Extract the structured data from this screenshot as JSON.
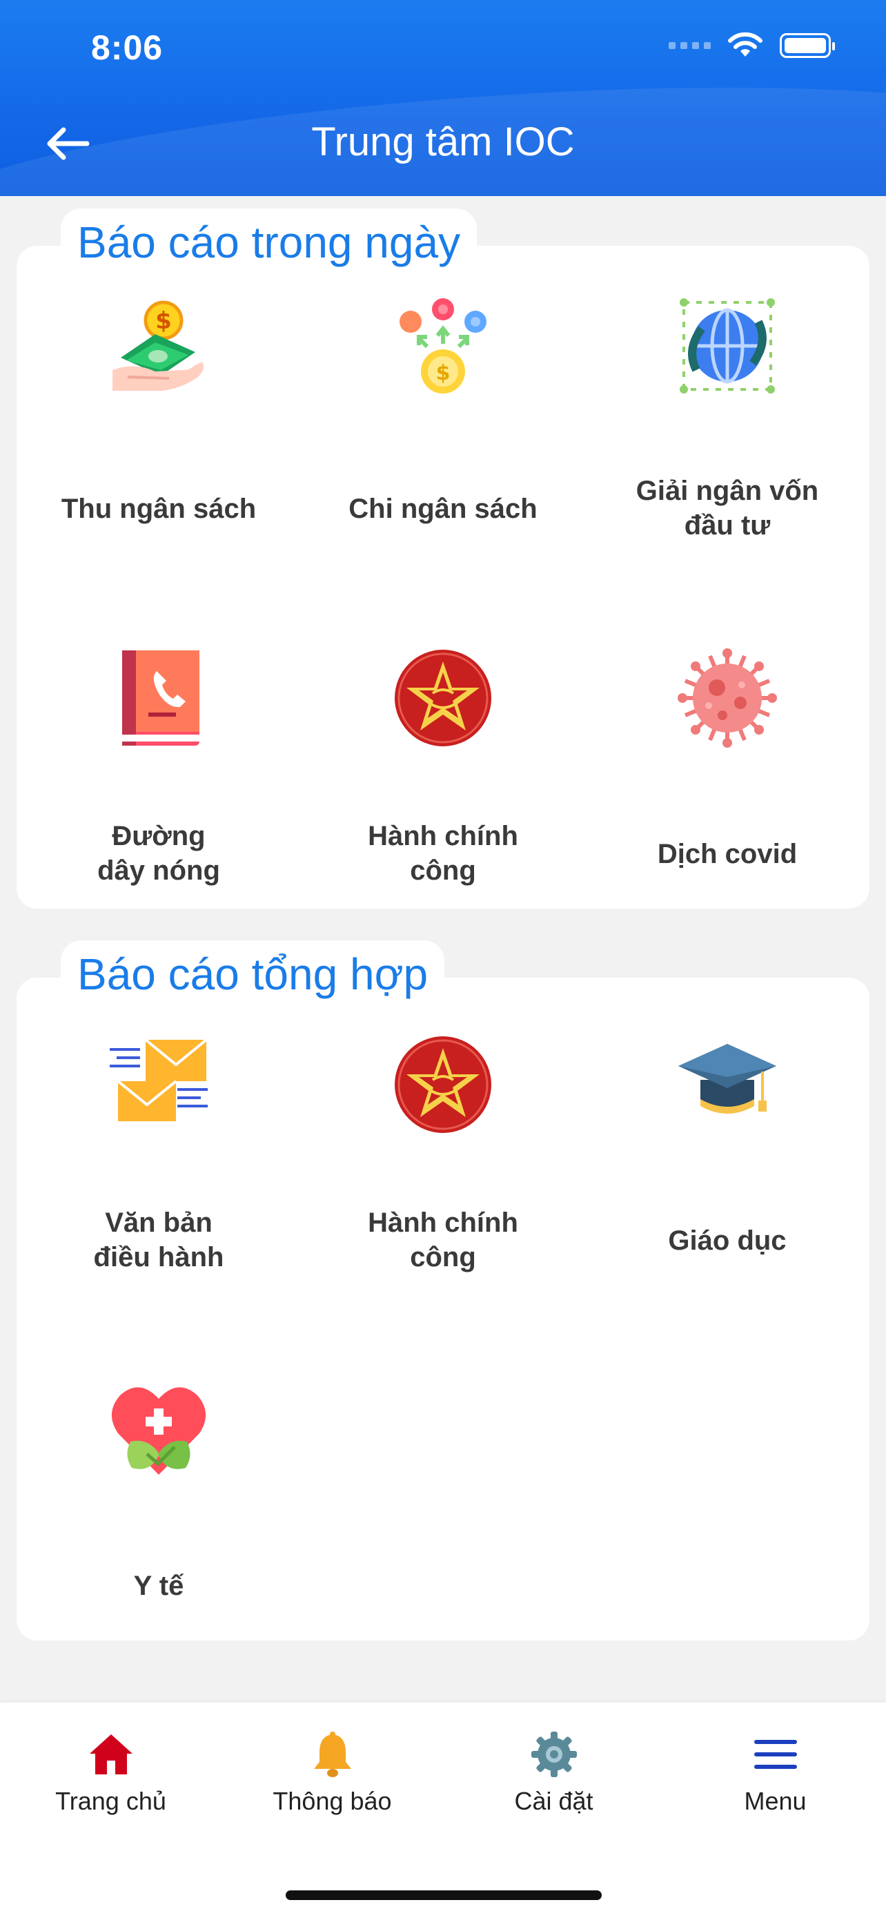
{
  "status_bar": {
    "time": "8:06"
  },
  "header": {
    "title": "Trung tâm IOC"
  },
  "sections": [
    {
      "title": "Báo cáo trong ngày",
      "items": [
        {
          "label": "Thu ngân sách",
          "icon": "money-hand-icon"
        },
        {
          "label": "Chi ngân sách",
          "icon": "coins-distribution-icon"
        },
        {
          "label": "Giải ngân vốn\nđầu tư",
          "icon": "globe-exchange-icon"
        },
        {
          "label": "Đường\ndây nóng",
          "icon": "phone-book-icon"
        },
        {
          "label": "Hành chính\ncông",
          "icon": "star-emblem-icon"
        },
        {
          "label": "Dịch covid",
          "icon": "virus-icon"
        }
      ]
    },
    {
      "title": "Báo cáo tổng hợp",
      "items": [
        {
          "label": "Văn bản\nđiều hành",
          "icon": "envelopes-icon"
        },
        {
          "label": "Hành chính\ncông",
          "icon": "star-emblem-icon"
        },
        {
          "label": "Giáo dục",
          "icon": "graduation-cap-icon"
        },
        {
          "label": "Y tế",
          "icon": "health-heart-icon"
        }
      ]
    }
  ],
  "bottom_nav": [
    {
      "label": "Trang chủ",
      "icon": "home-icon",
      "color": "#d0021b"
    },
    {
      "label": "Thông báo",
      "icon": "bell-icon",
      "color": "#f5a623"
    },
    {
      "label": "Cài đặt",
      "icon": "gear-icon",
      "color": "#5a8a9a"
    },
    {
      "label": "Menu",
      "icon": "hamburger-menu-icon",
      "color": "#1b3fbf"
    }
  ]
}
